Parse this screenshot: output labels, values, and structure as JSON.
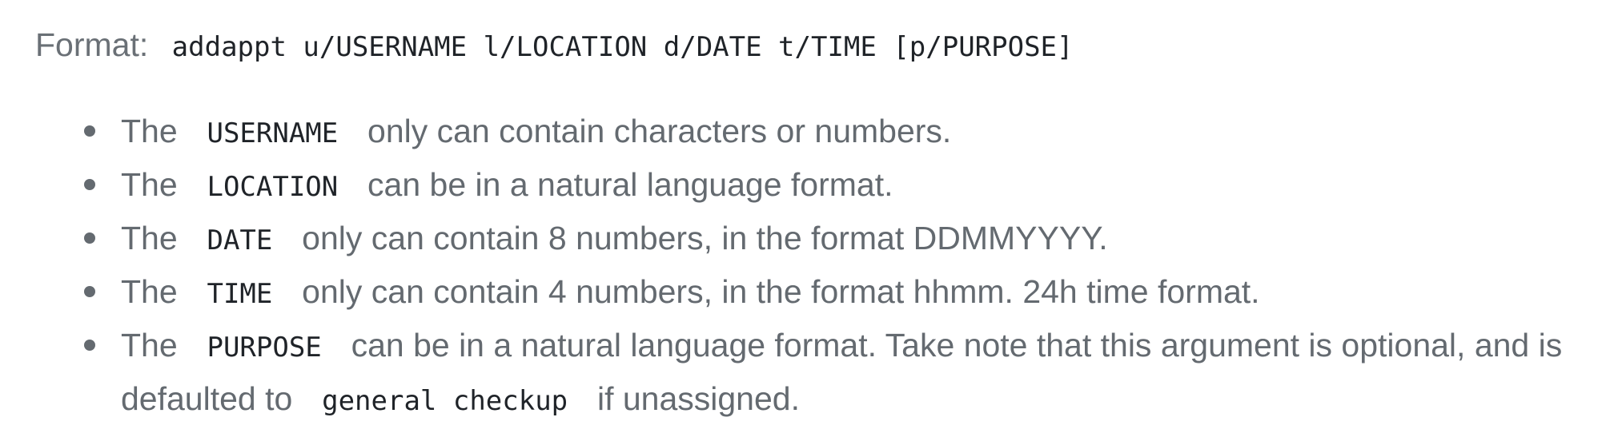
{
  "format": {
    "label": "Format:",
    "command": "addappt u/USERNAME l/LOCATION d/DATE t/TIME [p/PURPOSE]"
  },
  "bullets": [
    {
      "prefix": "The",
      "code": "USERNAME",
      "suffix": "only can contain characters or numbers."
    },
    {
      "prefix": "The",
      "code": "LOCATION",
      "suffix": "can be in a natural language format."
    },
    {
      "prefix": "The",
      "code": "DATE",
      "suffix": "only can contain 8 numbers, in the format DDMMYYYY."
    },
    {
      "prefix": "The",
      "code": "TIME",
      "suffix": "only can contain 4 numbers, in the format hhmm. 24h time format."
    },
    {
      "prefix": "The",
      "code": "PURPOSE",
      "suffix": "can be in a natural language format. Take note that this argument is optional, and is defaulted to",
      "code2": "general checkup",
      "suffix2": "if unassigned."
    }
  ]
}
